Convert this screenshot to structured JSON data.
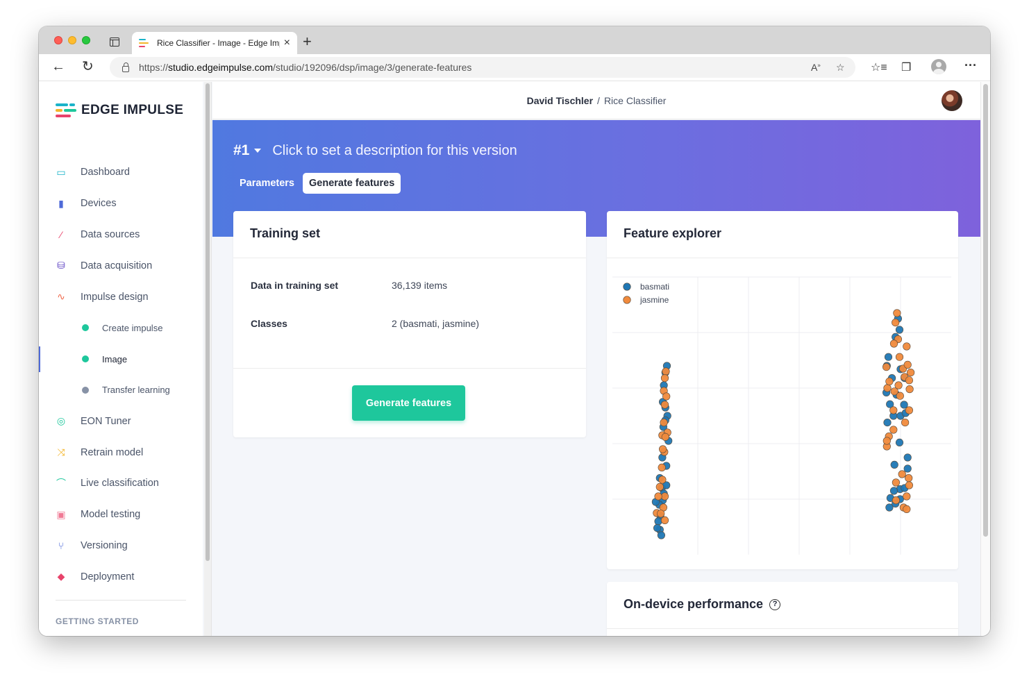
{
  "browser": {
    "tab_title": "Rice Classifier - Image - Edge Impulse",
    "url_prefix": "https://",
    "url_host": "studio.edgeimpulse.com",
    "url_path": "/studio/192096/dsp/image/3/generate-features"
  },
  "sidebar": {
    "logo": "EDGE IMPULSE",
    "items": [
      {
        "label": "Dashboard",
        "icon": "monitor-icon",
        "color": "#1ab3c9"
      },
      {
        "label": "Devices",
        "icon": "chip-icon",
        "color": "#4e6ad8"
      },
      {
        "label": "Data sources",
        "icon": "magic-wand-icon",
        "color": "#e8436b"
      },
      {
        "label": "Data acquisition",
        "icon": "database-icon",
        "color": "#5b3fc2"
      },
      {
        "label": "Impulse design",
        "icon": "pulse-icon",
        "color": "#f06a4d"
      },
      {
        "label": "Create impulse",
        "sub": true,
        "status_color": "#1ec79c"
      },
      {
        "label": "Image",
        "sub": true,
        "active": true,
        "status_color": "#1ec79c"
      },
      {
        "label": "Transfer learning",
        "sub": true,
        "status_color": "#8792a6"
      },
      {
        "label": "EON Tuner",
        "icon": "compass-icon",
        "color": "#1ec79c"
      },
      {
        "label": "Retrain model",
        "icon": "shuffle-icon",
        "color": "#f3b52a"
      },
      {
        "label": "Live classification",
        "icon": "curve-icon",
        "color": "#1ec79c"
      },
      {
        "label": "Model testing",
        "icon": "clipboard-check-icon",
        "color": "#f07a95"
      },
      {
        "label": "Versioning",
        "icon": "branch-icon",
        "color": "#4e6ad8"
      },
      {
        "label": "Deployment",
        "icon": "box-icon",
        "color": "#e8436b"
      }
    ],
    "section": "GETTING STARTED"
  },
  "header": {
    "user": "David Tischler",
    "separator": "/",
    "project": "Rice Classifier"
  },
  "hero": {
    "version": "#1",
    "description": "Click to set a description for this version",
    "tabs": [
      "Parameters",
      "Generate features"
    ],
    "active_tab": "Generate features"
  },
  "training_set": {
    "title": "Training set",
    "rows": [
      {
        "label": "Data in training set",
        "value": "36,139 items"
      },
      {
        "label": "Classes",
        "value": "2 (basmati, jasmine)"
      }
    ],
    "button": "Generate features"
  },
  "feature_explorer": {
    "title": "Feature explorer",
    "legend": [
      {
        "name": "basmati",
        "color": "#1f77b4"
      },
      {
        "name": "jasmine",
        "color": "#f08a3c"
      }
    ]
  },
  "performance": {
    "title": "On-device performance",
    "help_icon": "?"
  },
  "chart_data": {
    "type": "scatter",
    "title": "",
    "xlabel": "",
    "ylabel": "",
    "xlim": [
      0,
      6
    ],
    "ylim": [
      0,
      5
    ],
    "grid": true,
    "legend_position": "top-left",
    "series": [
      {
        "name": "basmati",
        "color": "#1f77b4",
        "points": [
          [
            0.39,
            3.4
          ],
          [
            0.36,
            3.28
          ],
          [
            0.33,
            3.05
          ],
          [
            0.31,
            2.75
          ],
          [
            0.36,
            2.65
          ],
          [
            0.4,
            2.5
          ],
          [
            0.36,
            2.42
          ],
          [
            0.32,
            2.3
          ],
          [
            0.42,
            2.05
          ],
          [
            0.3,
            1.75
          ],
          [
            0.38,
            1.6
          ],
          [
            0.25,
            1.38
          ],
          [
            0.29,
            1.2
          ],
          [
            0.31,
            0.98
          ],
          [
            0.24,
            0.9
          ],
          [
            0.26,
            0.7
          ],
          [
            0.22,
            0.6
          ],
          [
            0.25,
            0.45
          ],
          [
            0.28,
            0.35
          ],
          [
            0.2,
            0.48
          ],
          [
            0.33,
            1.1
          ],
          [
            0.38,
            1.25
          ],
          [
            0.17,
            0.95
          ],
          [
            4.95,
            4.25
          ],
          [
            4.98,
            4.05
          ],
          [
            4.9,
            3.92
          ],
          [
            4.76,
            3.56
          ],
          [
            4.73,
            3.4
          ],
          [
            5.0,
            3.34
          ],
          [
            5.08,
            3.18
          ],
          [
            4.83,
            3.18
          ],
          [
            4.72,
            2.92
          ],
          [
            4.92,
            2.88
          ],
          [
            5.07,
            2.7
          ],
          [
            4.79,
            2.71
          ],
          [
            4.86,
            2.5
          ],
          [
            5.0,
            2.5
          ],
          [
            5.1,
            2.55
          ],
          [
            4.74,
            2.38
          ],
          [
            4.98,
            2.02
          ],
          [
            5.14,
            1.75
          ],
          [
            5.14,
            1.55
          ],
          [
            4.88,
            1.62
          ],
          [
            4.99,
            1.18
          ],
          [
            4.87,
            1.15
          ],
          [
            4.99,
            1.0
          ],
          [
            5.08,
            1.2
          ],
          [
            4.8,
            1.02
          ],
          [
            4.9,
            0.92
          ],
          [
            4.78,
            0.85
          ]
        ]
      },
      {
        "name": "jasmine",
        "color": "#f08a3c",
        "points": [
          [
            0.37,
            3.3
          ],
          [
            0.35,
            3.18
          ],
          [
            0.33,
            2.95
          ],
          [
            0.38,
            2.85
          ],
          [
            0.35,
            2.7
          ],
          [
            0.33,
            2.38
          ],
          [
            0.4,
            2.2
          ],
          [
            0.3,
            2.15
          ],
          [
            0.36,
            2.12
          ],
          [
            0.34,
            1.85
          ],
          [
            0.29,
            1.57
          ],
          [
            0.25,
            1.22
          ],
          [
            0.35,
            1.05
          ],
          [
            0.32,
            0.85
          ],
          [
            0.19,
            0.75
          ],
          [
            0.27,
            0.74
          ],
          [
            0.3,
            1.35
          ],
          [
            0.22,
            1.05
          ],
          [
            0.35,
            0.62
          ],
          [
            0.31,
            1.9
          ],
          [
            4.93,
            4.35
          ],
          [
            4.9,
            4.18
          ],
          [
            4.95,
            3.88
          ],
          [
            4.87,
            3.8
          ],
          [
            4.98,
            3.56
          ],
          [
            5.12,
            3.75
          ],
          [
            5.05,
            3.35
          ],
          [
            5.08,
            3.2
          ],
          [
            5.17,
            3.14
          ],
          [
            5.2,
            3.28
          ],
          [
            5.14,
            3.42
          ],
          [
            4.72,
            3.38
          ],
          [
            4.74,
            3.0
          ],
          [
            4.78,
            3.12
          ],
          [
            4.88,
            2.94
          ],
          [
            4.96,
            3.05
          ],
          [
            5.18,
            2.98
          ],
          [
            4.86,
            2.6
          ],
          [
            4.99,
            2.86
          ],
          [
            5.09,
            2.38
          ],
          [
            5.17,
            2.6
          ],
          [
            4.77,
            2.13
          ],
          [
            4.73,
            1.95
          ],
          [
            4.73,
            2.05
          ],
          [
            4.86,
            2.25
          ],
          [
            5.17,
            1.25
          ],
          [
            5.16,
            1.38
          ],
          [
            5.12,
            1.05
          ],
          [
            5.06,
            0.85
          ],
          [
            5.12,
            0.82
          ],
          [
            4.91,
            1.3
          ],
          [
            4.91,
            0.98
          ],
          [
            5.03,
            1.45
          ]
        ]
      }
    ]
  }
}
